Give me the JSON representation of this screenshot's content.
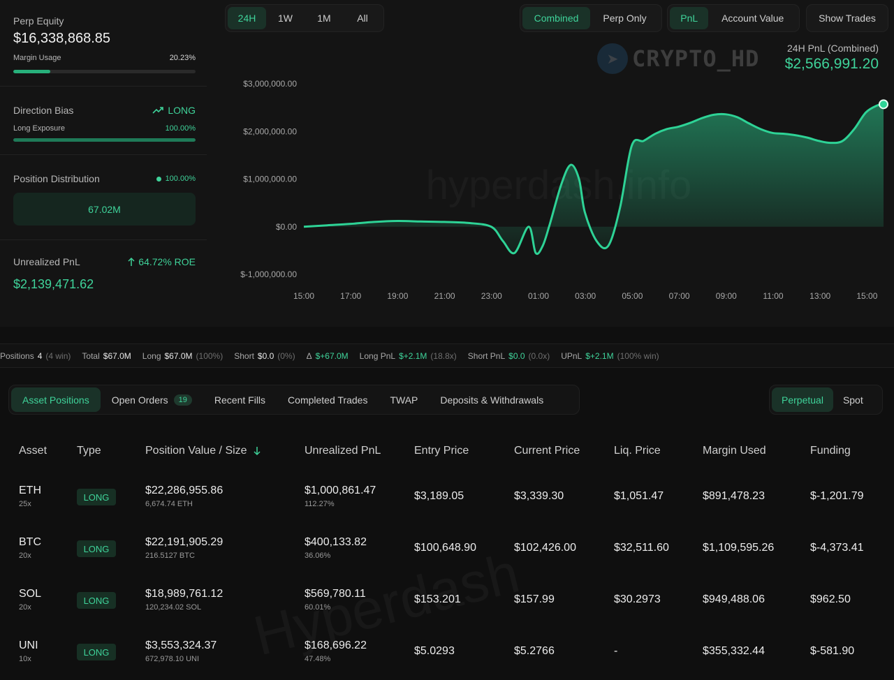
{
  "left_panel": {
    "perp_equity_label": "Perp Equity",
    "perp_equity_value": "$16,338,868.85",
    "margin_usage_label": "Margin Usage",
    "margin_usage_value": "20.23%",
    "margin_usage_fraction": 0.2023,
    "direction_bias_label": "Direction Bias",
    "direction_bias_value": "LONG",
    "long_exposure_label": "Long Exposure",
    "long_exposure_value": "100.00%",
    "long_exposure_fraction": 1.0,
    "position_distribution_label": "Position Distribution",
    "position_distribution_pct": "100.00%",
    "position_distribution_value": "67.02M",
    "unrealized_pnl_label": "Unrealized PnL",
    "roe_value": "64.72% ROE",
    "unrealized_pnl_value": "$2,139,471.62"
  },
  "time_tabs": [
    "24H",
    "1W",
    "1M",
    "All"
  ],
  "time_tab_active": "24H",
  "mode_tabs": [
    "Combined",
    "Perp Only"
  ],
  "mode_tab_active": "Combined",
  "metric_tabs": [
    "PnL",
    "Account Value"
  ],
  "metric_tab_active": "PnL",
  "show_trades_label": "Show Trades",
  "chart_header": {
    "label": "24H PnL (Combined)",
    "value": "$2,566,991.20"
  },
  "watermarks": {
    "brand": "CRYPTO_HD",
    "site": "hyperdash.info",
    "table": "Hyperdash"
  },
  "chart_data": {
    "type": "area",
    "ylim": [
      -1000000,
      3000000
    ],
    "y_ticks": [
      "$3,000,000.00",
      "$2,000,000.00",
      "$1,000,000.00",
      "$0.00",
      "$-1,000,000.00"
    ],
    "x_ticks": [
      "15:00",
      "17:00",
      "19:00",
      "21:00",
      "23:00",
      "01:00",
      "03:00",
      "05:00",
      "07:00",
      "09:00",
      "11:00",
      "13:00",
      "15:00"
    ],
    "x": [
      0,
      1,
      2,
      3,
      4,
      5,
      6,
      7,
      8,
      8.5,
      9,
      9.6,
      9.9,
      10.2,
      10.5,
      11,
      11.4,
      11.75,
      12,
      12.5,
      13,
      13.5,
      14,
      14.5,
      15,
      15.5,
      16,
      16.5,
      17,
      17.5,
      18,
      18.5,
      19,
      19.5,
      20,
      20.5,
      21,
      21.5,
      22,
      22.5,
      23,
      23.5,
      24,
      24.5,
      24.75
    ],
    "values": [
      0,
      30000,
      60000,
      100000,
      120000,
      110000,
      100000,
      80000,
      0,
      -300000,
      -550000,
      0,
      -550000,
      -400000,
      50000,
      900000,
      1300000,
      1000000,
      300000,
      -300000,
      -400000,
      400000,
      1700000,
      1800000,
      1950000,
      2050000,
      2100000,
      2180000,
      2280000,
      2350000,
      2360000,
      2300000,
      2170000,
      2050000,
      1970000,
      1950000,
      1920000,
      1870000,
      1800000,
      1760000,
      1800000,
      2050000,
      2400000,
      2550000,
      2570000
    ]
  },
  "stats_bar": [
    {
      "k": "Positions",
      "v": "4",
      "p": "(4 win)",
      "green": false
    },
    {
      "k": "Total",
      "v": "$67.0M",
      "p": "",
      "green": false
    },
    {
      "k": "Long",
      "v": "$67.0M",
      "p": "(100%)",
      "green": false
    },
    {
      "k": "Short",
      "v": "$0.0",
      "p": "(0%)",
      "green": false
    },
    {
      "k": "Δ",
      "v": "$+67.0M",
      "p": "",
      "green": true
    },
    {
      "k": "Long PnL",
      "v": "$+2.1M",
      "p": "(18.8x)",
      "green": true
    },
    {
      "k": "Short PnL",
      "v": "$0.0",
      "p": "(0.0x)",
      "green": true
    },
    {
      "k": "UPnL",
      "v": "$+2.1M",
      "p": "(100% win)",
      "green": true
    }
  ],
  "bottom_tabs": [
    {
      "label": "Asset Positions",
      "badge": ""
    },
    {
      "label": "Open Orders",
      "badge": "19"
    },
    {
      "label": "Recent Fills",
      "badge": ""
    },
    {
      "label": "Completed Trades",
      "badge": ""
    },
    {
      "label": "TWAP",
      "badge": ""
    },
    {
      "label": "Deposits & Withdrawals",
      "badge": ""
    }
  ],
  "bottom_tab_active": "Asset Positions",
  "product_tabs": [
    "Perpetual",
    "Spot"
  ],
  "product_tab_active": "Perpetual",
  "table": {
    "headers": [
      "Asset",
      "Type",
      "Position Value / Size",
      "Unrealized PnL",
      "Entry Price",
      "Current Price",
      "Liq. Price",
      "Margin Used",
      "Funding"
    ],
    "rows": [
      {
        "asset": "ETH",
        "leverage": "25x",
        "type": "LONG",
        "value": "$22,286,955.86",
        "size": "6,674.74 ETH",
        "pnl": "$1,000,861.47",
        "pnl_pct": "112.27%",
        "entry": "$3,189.05",
        "current": "$3,339.30",
        "liq": "$1,051.47",
        "margin": "$891,478.23",
        "funding": "$-1,201.79",
        "funding_positive": false
      },
      {
        "asset": "BTC",
        "leverage": "20x",
        "type": "LONG",
        "value": "$22,191,905.29",
        "size": "216.5127 BTC",
        "pnl": "$400,133.82",
        "pnl_pct": "36.06%",
        "entry": "$100,648.90",
        "current": "$102,426.00",
        "liq": "$32,511.60",
        "margin": "$1,109,595.26",
        "funding": "$-4,373.41",
        "funding_positive": false
      },
      {
        "asset": "SOL",
        "leverage": "20x",
        "type": "LONG",
        "value": "$18,989,761.12",
        "size": "120,234.02 SOL",
        "pnl": "$569,780.11",
        "pnl_pct": "60.01%",
        "entry": "$153.201",
        "current": "$157.99",
        "liq": "$30.2973",
        "margin": "$949,488.06",
        "funding": "$962.50",
        "funding_positive": true
      },
      {
        "asset": "UNI",
        "leverage": "10x",
        "type": "LONG",
        "value": "$3,553,324.37",
        "size": "672,978.10 UNI",
        "pnl": "$168,696.22",
        "pnl_pct": "47.48%",
        "entry": "$5.0293",
        "current": "$5.2766",
        "liq": "-",
        "margin": "$355,332.44",
        "funding": "$-581.90",
        "funding_positive": false
      }
    ]
  },
  "colors": {
    "accent": "#3fd39a",
    "negative": "#ef5f5f",
    "background": "#0f0f0f",
    "panel": "#141414"
  }
}
